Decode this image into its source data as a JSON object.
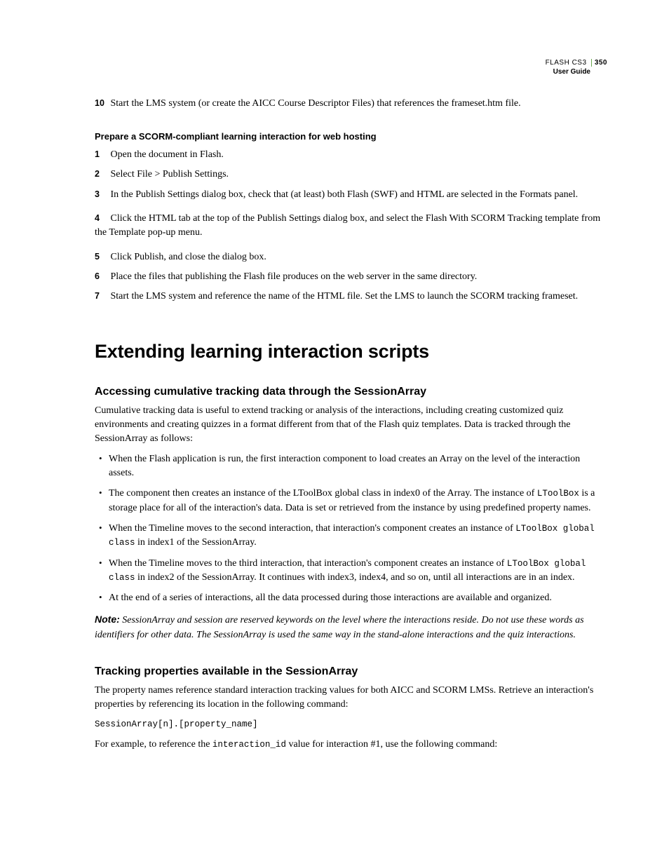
{
  "header": {
    "line1": "FLASH CS3",
    "page_number": "350",
    "line2": "User Guide"
  },
  "pretext_step": {
    "num": "10",
    "text": "Start the LMS system (or create the AICC Course Descriptor Files) that references the frameset.htm file."
  },
  "scorm_section": {
    "subhead": "Prepare a SCORM-compliant learning interaction for web hosting",
    "steps": [
      {
        "num": "1",
        "text": "Open the document in Flash."
      },
      {
        "num": "2",
        "text": "Select File > Publish Settings."
      },
      {
        "num": "3",
        "text": "In the Publish Settings dialog box, check that (at least) both Flash (SWF) and HTML are selected in the Formats panel."
      },
      {
        "num": "4",
        "text": "Click the HTML tab at the top of the Publish Settings dialog box, and select the Flash With SCORM Tracking template from the Template pop-up menu."
      },
      {
        "num": "5",
        "text": "Click Publish, and close the dialog box."
      },
      {
        "num": "6",
        "text": "Place the files that publishing the Flash file produces on the web server in the same directory."
      },
      {
        "num": "7",
        "text": "Start the LMS system and reference the name of the HTML file. Set the LMS to launch the SCORM tracking frameset."
      }
    ]
  },
  "chapter_title": "Extending learning interaction scripts",
  "topic1": {
    "title": "Accessing cumulative tracking data through the SessionArray",
    "intro": "Cumulative tracking data is useful to extend tracking or analysis of the interactions, including creating customized quiz environments and creating quizzes in a format different from that of the Flash quiz templates. Data is tracked through the SessionArray as follows:",
    "bullets": {
      "b1": "When the Flash application is run, the first interaction component to load creates an Array on the level of the interaction assets.",
      "b2_pre": "The component then creates an instance of the LToolBox global class in index0 of the Array. The instance of ",
      "b2_code": "LToolBox",
      "b2_post": " is a storage place for all of the interaction's data. Data is set or retrieved from the instance by using predefined property names.",
      "b3_pre": "When the Timeline moves to the second interaction, that interaction's component creates an instance of ",
      "b3_code": "LToolBox global class",
      "b3_post": " in index1 of the SessionArray.",
      "b4_pre": "When the Timeline moves to the third interaction, that interaction's component creates an instance of ",
      "b4_code": "LToolBox global class",
      "b4_post": " in index2 of the SessionArray. It continues with index3, index4, and so on, until all interactions are in an index.",
      "b5": "At the end of a series of interactions, all the data processed during those interactions are available and organized."
    },
    "note_label": "Note:",
    "note": "SessionArray and session are reserved keywords on the level where the interactions reside. Do not use these words as identifiers for other data. The SessionArray is used the same way in the stand-alone interactions and the quiz interactions."
  },
  "topic2": {
    "title": "Tracking properties available in the SessionArray",
    "intro": "The property names reference standard interaction tracking values for both AICC and SCORM LMSs. Retrieve an interaction's properties by referencing its location in the following command:",
    "code": "SessionArray[n].[property_name]",
    "para2_pre": "For example, to reference the ",
    "para2_code": "interaction_id",
    "para2_post": " value for interaction #1, use the following command:"
  }
}
